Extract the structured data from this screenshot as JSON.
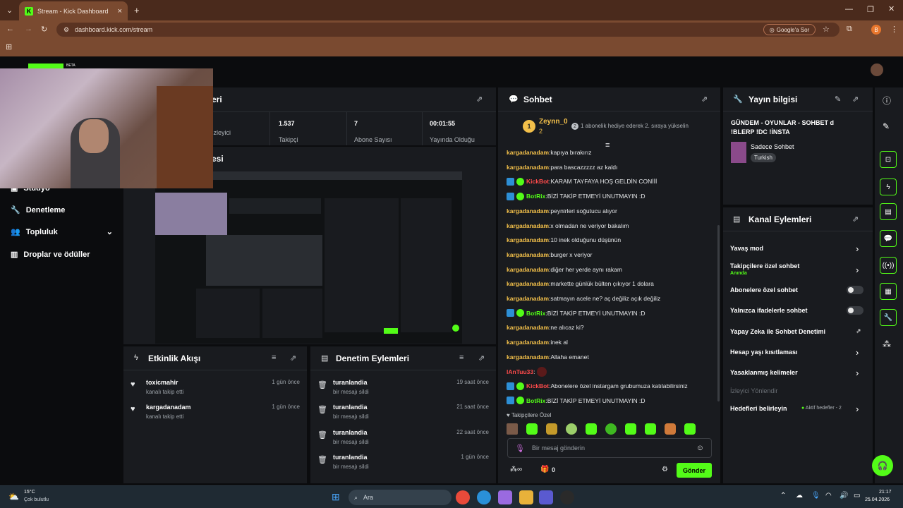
{
  "browser": {
    "tab_title": "Stream - Kick Dashboard",
    "url": "dashboard.kick.com/stream",
    "google_sor": "Google'a Sor",
    "profile_initial": "B"
  },
  "app": {
    "logo_badge": "BETA"
  },
  "stream_panel": {
    "title": "Yayın Metrikleri",
    "title_visible": "eri",
    "stats": [
      {
        "value": "",
        "label": "İzleyici"
      },
      {
        "value": "1.537",
        "label": "Takipçi"
      },
      {
        "value": "7",
        "label": "Abone Sayısı"
      },
      {
        "value": "00:01:55",
        "label": "Yayında Olduğu"
      }
    ],
    "preview_title_visible": "esi"
  },
  "nav": {
    "items": [
      {
        "label": "Stüdyo"
      },
      {
        "label": "Denetleme"
      },
      {
        "label": "Topluluk"
      },
      {
        "label": "Droplar ve ödüller"
      }
    ]
  },
  "activity_feed": {
    "title": "Etkinlik Akışı",
    "rows": [
      {
        "name": "toxicmahir",
        "sub": "kanalı takip etti",
        "time": "1 gün önce"
      },
      {
        "name": "kargadanadam",
        "sub": "kanalı takip etti",
        "time": "1 gün önce"
      }
    ]
  },
  "mod_actions": {
    "title": "Denetim Eylemleri",
    "rows": [
      {
        "name": "turanlandia",
        "sub": "bir mesajı sildi",
        "time": "19 saat önce"
      },
      {
        "name": "turanlandia",
        "sub": "bir mesajı sildi",
        "time": "21 saat önce"
      },
      {
        "name": "turanlandia",
        "sub": "bir mesajı sildi",
        "time": "22 saat önce"
      },
      {
        "name": "turanlandia",
        "sub": "bir mesajı sildi",
        "time": "1 gün önce"
      }
    ]
  },
  "chat": {
    "title": "Sohbet",
    "pinned": {
      "rank": "1",
      "user": "Zeynn_0",
      "count": "2",
      "event_count": "2",
      "event_text": "1 abonelik hediye ederek 2. sıraya yükselin"
    },
    "messages": [
      {
        "user": "kargadanadam",
        "text": "kapıya bırakırız",
        "type": "y"
      },
      {
        "user": "kargadanadam",
        "text": "para bascazzzzz az kaldı",
        "type": "y"
      },
      {
        "user": "KickBot",
        "text": "KARAM TAYFAYA HOŞ GELDİN CONİİİ",
        "type": "r"
      },
      {
        "user": "BotRix",
        "text": "BİZİ TAKİP ETMEYİ UNUTMAYIN :D",
        "type": "g"
      },
      {
        "user": "kargadanadam",
        "text": "peynirleri soğutucu alıyor",
        "type": "y"
      },
      {
        "user": "kargadanadam",
        "text": "x olmadan ne veriyor bakalım",
        "type": "y"
      },
      {
        "user": "kargadanadam",
        "text": "10 inek olduğunu düşünün",
        "type": "y"
      },
      {
        "user": "kargadanadam",
        "text": "burger x veriyor",
        "type": "y"
      },
      {
        "user": "kargadanadam",
        "text": "diğer her yerde aynı rakam",
        "type": "y"
      },
      {
        "user": "kargadanadam",
        "text": "markette günlük bülten çıkıyor 1 dolara",
        "type": "y"
      },
      {
        "user": "kargadanadam",
        "text": "satmayın acele ne? aç değiliz açık değiliz",
        "type": "y"
      },
      {
        "user": "BotRix",
        "text": "BİZİ TAKİP ETMEYİ UNUTMAYIN :D",
        "type": "g"
      },
      {
        "user": "kargadanadam",
        "text": "ne alıcaz ki?",
        "type": "y"
      },
      {
        "user": "kargadanadam",
        "text": "inek al",
        "type": "y"
      },
      {
        "user": "kargadanadam",
        "text": "Allaha emanet",
        "type": "y"
      },
      {
        "user": "lAnTuu33",
        "text": "",
        "type": "p"
      },
      {
        "user": "KickBot",
        "text": "Abonelere özel instargam grubumuza katılabilirsiniz",
        "type": "r"
      },
      {
        "user": "BotRix",
        "text": "BİZİ TAKİP ETMEYİ UNUTMAYIN :D",
        "type": "g"
      }
    ],
    "followers_only": "Takipçilere Özel",
    "input_placeholder": "Bir mesaj gönderin",
    "points_value": "0",
    "send_label": "Gönder"
  },
  "stream_info": {
    "title": "Yayın bilgisi",
    "stream_title": "GÜNDEM - OYUNLAR - SOHBET d !BLERP !DC !İNSTA",
    "category": "Sadece Sohbet",
    "language": "Turkish"
  },
  "channel_actions": {
    "title": "Kanal Eylemleri",
    "items": [
      {
        "label": "Yavaş mod",
        "sub": ""
      },
      {
        "label": "Takipçilere özel sohbet",
        "sub": "Anında"
      },
      {
        "label": "Abonelere özel sohbet",
        "sub": ""
      },
      {
        "label": "Yalnızca ifadelerle sohbet",
        "sub": ""
      },
      {
        "label": "Yapay Zeka ile Sohbet Denetimi",
        "sub": ""
      },
      {
        "label": "Hesap yaşı kısıtlaması",
        "sub": ""
      },
      {
        "label": "Yasaklanmış kelimeler",
        "sub": ""
      },
      {
        "label": "İzleyici Yönlendir",
        "sub": ""
      },
      {
        "label": "Hedefleri belirleyin",
        "sub": "Aktif hedefler - 2"
      }
    ]
  },
  "taskbar": {
    "weather_temp": "15°C",
    "weather_desc": "Çok bulutlu",
    "search": "Ara",
    "time": "21:17",
    "date": "25.04.2026"
  },
  "colors": {
    "kick_green": "#53fc18",
    "panel": "#191b1f",
    "chrome": "#7a4a30"
  }
}
